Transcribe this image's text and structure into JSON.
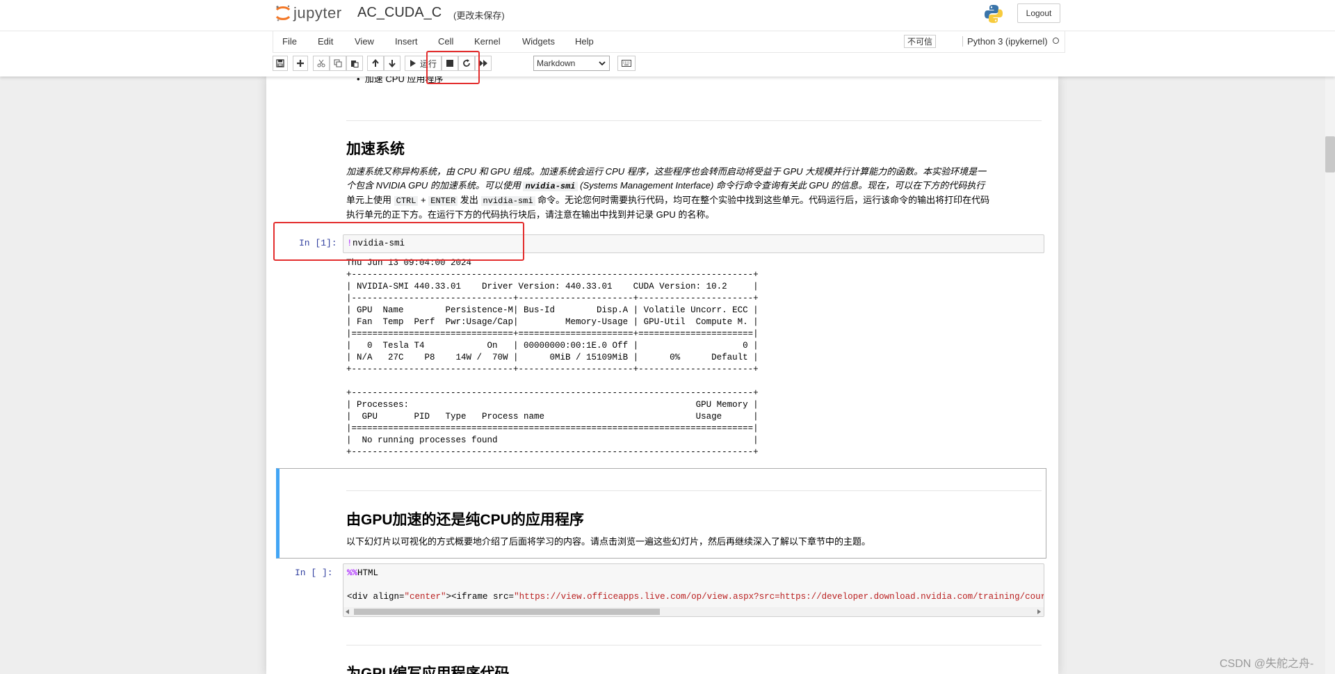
{
  "header": {
    "app_name": "jupyter",
    "notebook_name": "AC_CUDA_C",
    "save_status": "(更改未保存)",
    "logout_label": "Logout"
  },
  "menubar": {
    "items": [
      "File",
      "Edit",
      "View",
      "Insert",
      "Cell",
      "Kernel",
      "Widgets",
      "Help"
    ],
    "trust_label": "不可信",
    "kernel_name": "Python 3 (ipykernel)"
  },
  "toolbar": {
    "run_label": "运行",
    "cell_type": "Markdown"
  },
  "cells": {
    "top_fragment": "加速 CPU 应用程序",
    "section1": {
      "heading": "加速系统",
      "para_l1": "加速系统又称异构系统，由 CPU 和 GPU 组成。加速系统会运行 CPU 程序，这些程序也会转而启动将受益于 GPU 大规模并行计算能力的函数。本实验环境是一",
      "para_l2a": "个包含 NVIDIA GPU 的加速系统。可以使用 ",
      "para_l2_code": "nvidia-smi",
      "para_l2b": " (Systems Management Interface) 命令行命令查询有关此 GPU 的信息。现在，可以在下方的代码执行",
      "para_l3a": "单元上使用 ",
      "para_l3_code1": "CTRL",
      "para_l3_plus": " + ",
      "para_l3_code2": "ENTER",
      "para_l3b": " 发出 ",
      "para_l3_code3": "nvidia-smi",
      "para_l3c": " 命令。无论您何时需要执行代码，均可在整个实验中找到这些单元。代码运行后，运行该命令的输出将打印在代码",
      "para_l4": "执行单元的正下方。在运行下方的代码执行块后，请注意在输出中找到并记录 GPU 的名称。"
    },
    "code1": {
      "prompt": "In  [1]:",
      "bang": "!",
      "code": "nvidia-smi",
      "output": "Thu Jun 13 09:04:00 2024\n+-----------------------------------------------------------------------------+\n| NVIDIA-SMI 440.33.01    Driver Version: 440.33.01    CUDA Version: 10.2     |\n|-------------------------------+----------------------+----------------------+\n| GPU  Name        Persistence-M| Bus-Id        Disp.A | Volatile Uncorr. ECC |\n| Fan  Temp  Perf  Pwr:Usage/Cap|         Memory-Usage | GPU-Util  Compute M. |\n|===============================+======================+======================|\n|   0  Tesla T4            On   | 00000000:00:1E.0 Off |                    0 |\n| N/A   27C    P8    14W /  70W |      0MiB / 15109MiB |      0%      Default |\n+-------------------------------+----------------------+----------------------+\n\n+-----------------------------------------------------------------------------+\n| Processes:                                                       GPU Memory |\n|  GPU       PID   Type   Process name                             Usage      |\n|=============================================================================|\n|  No running processes found                                                 |\n+-----------------------------------------------------------------------------+"
    },
    "section2": {
      "heading": "由GPU加速的还是纯CPU的应用程序",
      "para": "以下幻灯片以可视化的方式概要地介绍了后面将学习的内容。请点击浏览一遍这些幻灯片，然后再继续深入了解以下章节中的主题。"
    },
    "code2": {
      "prompt": "In  [ ]:",
      "magic": "%%",
      "magic_name": "HTML",
      "l2_a": "<div align=",
      "l2_attr": "\"center\"",
      "l2_b": "><iframe src=",
      "l2_url": "\"https://view.officeapps.live.com/op/view.aspx?src=https://developer.download.nvidia.com/training/courses/C-AC-"
    },
    "section3": {
      "heading": "为GPU编写应用程序代码"
    }
  },
  "watermark": "CSDN @失舵之舟-",
  "colors": {
    "accent_blue": "#42a5f5",
    "prompt_blue": "#303f9f",
    "highlight_red": "#e32d2d",
    "magic_purple": "#aa22ff",
    "string_red": "#ba2121"
  }
}
